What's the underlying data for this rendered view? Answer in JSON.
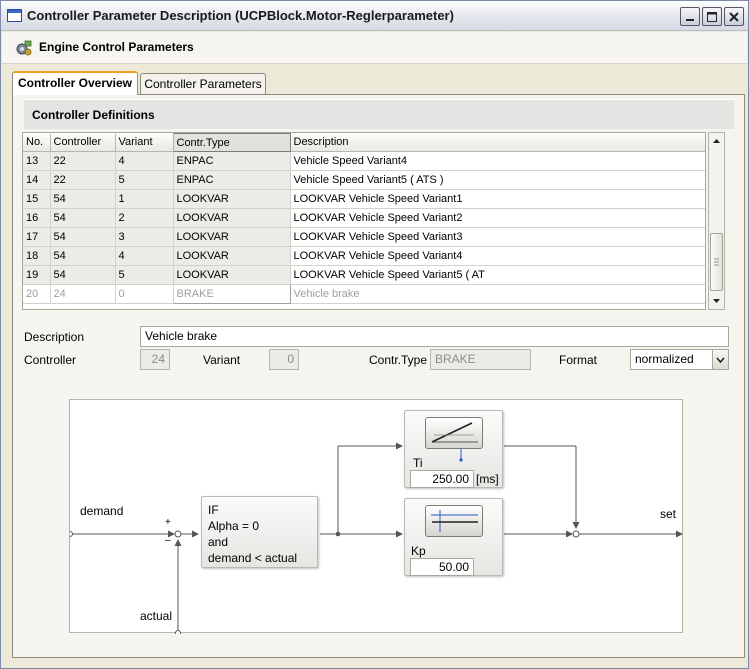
{
  "window": {
    "title": "Controller Parameter Description (UCPBlock.Motor-Reglerparameter)",
    "buttons": [
      "minimize",
      "maximize",
      "close"
    ]
  },
  "header": {
    "title": "Engine Control Parameters",
    "icon": "engine-icon"
  },
  "tabs": [
    {
      "label": "Controller Overview",
      "active": true
    },
    {
      "label": "Controller Parameters",
      "active": false
    }
  ],
  "group": {
    "title": "Controller Definitions"
  },
  "table": {
    "columns": [
      "No.",
      "Controller",
      "Variant",
      "Contr.Type",
      "Description"
    ],
    "rows": [
      [
        "13",
        "22",
        "4",
        "ENPAC",
        "Vehicle Speed Variant4"
      ],
      [
        "14",
        "22",
        "5",
        "ENPAC",
        "Vehicle Speed Variant5 ( ATS )"
      ],
      [
        "15",
        "54",
        "1",
        "LOOKVAR",
        "LOOKVAR Vehicle Speed Variant1"
      ],
      [
        "16",
        "54",
        "2",
        "LOOKVAR",
        "LOOKVAR Vehicle Speed Variant2"
      ],
      [
        "17",
        "54",
        "3",
        "LOOKVAR",
        "LOOKVAR Vehicle Speed Variant3"
      ],
      [
        "18",
        "54",
        "4",
        "LOOKVAR",
        "LOOKVAR Vehicle Speed Variant4"
      ],
      [
        "19",
        "54",
        "5",
        "LOOKVAR",
        "LOOKVAR Vehicle Speed Variant5 ( AT"
      ],
      [
        "20",
        "24",
        "0",
        "BRAKE",
        "Vehicle brake"
      ]
    ]
  },
  "details": {
    "description_label": "Description",
    "description_value": "Vehicle brake",
    "controller_label": "Controller",
    "controller_value": "24",
    "variant_label": "Variant",
    "variant_value": "0",
    "contr_type_label": "Contr.Type",
    "contr_type_value": "BRAKE",
    "format_label": "Format",
    "format_value": "normalized"
  },
  "diagram": {
    "demand_label": "demand",
    "actual_label": "actual",
    "set_label": "set",
    "plus": "+",
    "minus": "–",
    "condition_lines": [
      "IF",
      "Alpha = 0",
      "and",
      "demand < actual"
    ],
    "ti_label": "Ti",
    "ti_value": "250.00",
    "ti_unit": "[ms]",
    "kp_label": "Kp",
    "kp_value": "50.00"
  }
}
